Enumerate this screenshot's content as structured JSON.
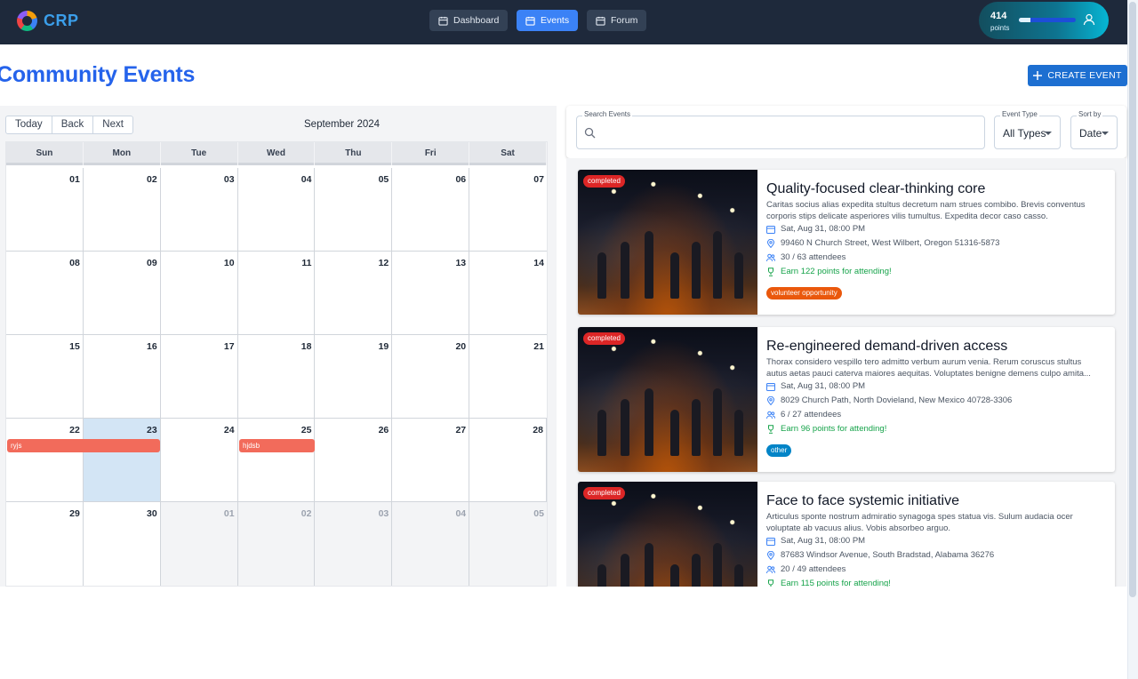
{
  "app": {
    "name": "CRP"
  },
  "nav": {
    "dashboard": "Dashboard",
    "events": "Events",
    "forum": "Forum"
  },
  "user": {
    "points": "414",
    "points_label": "points",
    "progress_fraction": 0.2
  },
  "page": {
    "title": "Community Events",
    "create_button": "CREATE EVENT"
  },
  "calendar": {
    "toolbar": {
      "today": "Today",
      "back": "Back",
      "next": "Next"
    },
    "month_label": "September 2024",
    "weekdays": [
      "Sun",
      "Mon",
      "Tue",
      "Wed",
      "Thu",
      "Fri",
      "Sat"
    ],
    "weeks": [
      [
        "01",
        "02",
        "03",
        "04",
        "05",
        "06",
        "07"
      ],
      [
        "08",
        "09",
        "10",
        "11",
        "12",
        "13",
        "14"
      ],
      [
        "15",
        "16",
        "17",
        "18",
        "19",
        "20",
        "21"
      ],
      [
        "22",
        "23",
        "24",
        "25",
        "26",
        "27",
        "28"
      ],
      [
        "29",
        "30",
        "01",
        "02",
        "03",
        "04",
        "05"
      ]
    ],
    "today": "23",
    "events": [
      {
        "label": "ryjs"
      },
      {
        "label": "hjdsb"
      }
    ]
  },
  "filters": {
    "search_label": "Search Events",
    "search_value": "",
    "type_label": "Event Type",
    "type_value": "All Types",
    "sort_label": "Sort by",
    "sort_value": "Date"
  },
  "events": [
    {
      "status": "completed",
      "title": "Quality-focused clear-thinking core",
      "description": "Caritas socius alias expedita stultus decretum nam strues combibo. Brevis conventus corporis stips delicate asperiores vilis tumultus. Expedita decor caso casso.",
      "date": "Sat, Aug 31, 08:00 PM",
      "location": "99460 N Church Street, West Wilbert, Oregon 51316-5873",
      "attendees": "30 / 63 attendees",
      "points": "Earn 122 points for attending!",
      "tag": "volunteer opportunity",
      "tag_color": "#ea580c"
    },
    {
      "status": "completed",
      "title": "Re-engineered demand-driven access",
      "description": "Thorax considero vespillo tero admitto verbum aurum venia. Rerum coruscus stultus autus aetas pauci caterva maiores aequitas. Voluptates benigne demens culpo amita...",
      "date": "Sat, Aug 31, 08:00 PM",
      "location": "8029 Church Path, North Dovieland, New Mexico 40728-3306",
      "attendees": "6 / 27 attendees",
      "points": "Earn 96 points for attending!",
      "tag": "other",
      "tag_color": "#0284c7"
    },
    {
      "status": "completed",
      "title": "Face to face systemic initiative",
      "description": "Articulus sponte nostrum admiratio synagoga spes statua vis. Sulum audacia ocer voluptate ab vacuus alius. Vobis absorbeo arguo.",
      "date": "Sat, Aug 31, 08:00 PM",
      "location": "87683 Windsor Avenue, South Bradstad, Alabama 36276",
      "attendees": "20 / 49 attendees",
      "points": "Earn 115 points for attending!",
      "tag": "",
      "tag_color": ""
    }
  ]
}
